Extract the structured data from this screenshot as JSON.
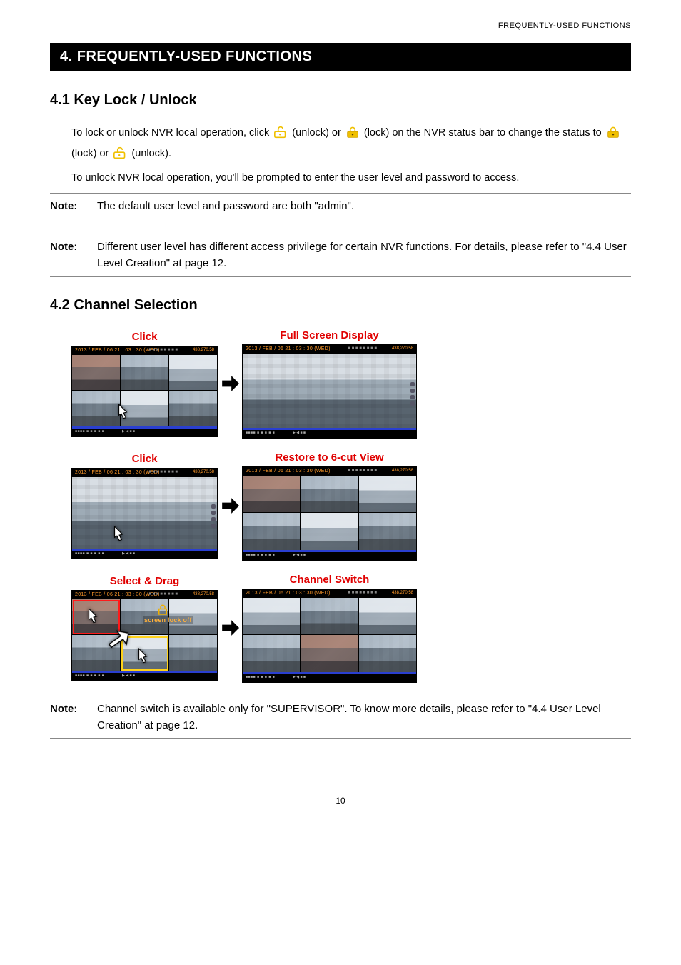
{
  "header": {
    "running_title": "FREQUENTLY-USED FUNCTIONS"
  },
  "section": {
    "bar_title": "4. FREQUENTLY-USED FUNCTIONS",
    "s41_title": "4.1 Key Lock / Unlock",
    "s41_p1a": "To lock or unlock NVR local operation, click ",
    "s41_p1b": " (unlock) or ",
    "s41_p1c": " (lock) on the NVR status bar to change the status to ",
    "s41_p1d": " (lock) or ",
    "s41_p1e": " (unlock).",
    "s41_p2": "To unlock NVR local operation, you'll be prompted to enter the user level and password to access.",
    "note1_label": "Note:",
    "note1_text": "The default user level and password are both \"admin\".",
    "note2_label": "Note:",
    "note2_text": "Different user level has different access privilege for certain NVR functions. For details, please refer to \"4.4 User Level Creation\" at page 12.",
    "s42_title": "4.2 Channel Selection",
    "fig": {
      "r1_l": "Click",
      "r1_r": "Full Screen Display",
      "r2_l": "Click",
      "r2_r": "Restore to 6-cut View",
      "r3_l": "Select & Drag",
      "r3_r": "Channel Switch",
      "timestamp": "2013 / FEB / 06  21 : 03 : 30 (WED)",
      "rate": "438,270.58",
      "screen_lock_off": "screen lock off"
    },
    "note3_label": "Note:",
    "note3_text": "Channel switch is available only for \"SUPERVISOR\". To know more details, please refer to \"4.4 User Level Creation\" at page 12."
  },
  "page_number": "10"
}
